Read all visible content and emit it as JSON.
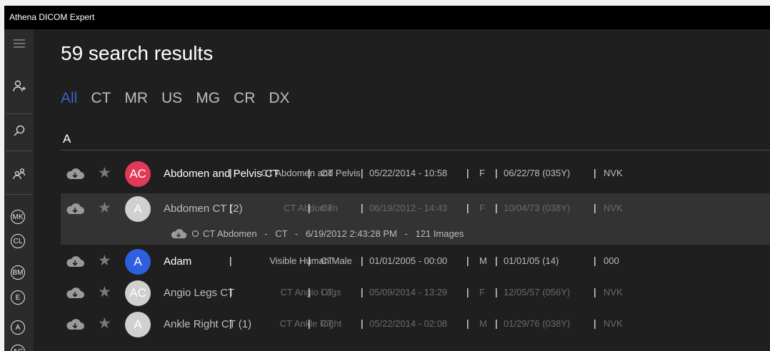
{
  "app": {
    "title": "Athena DICOM Expert"
  },
  "sidebar": {
    "recent_patients": [
      "MK",
      "CL",
      "BM",
      "E",
      "A",
      "AC"
    ]
  },
  "results": {
    "heading": "59 search results",
    "tabs": [
      "All",
      "CT",
      "MR",
      "US",
      "MG",
      "CR",
      "DX"
    ],
    "active_tab": "All",
    "group_letter": "A"
  },
  "patients": [
    {
      "initials": "AC",
      "avatar_color": "#e03a57",
      "name": "Abdomen and Pelvis CT",
      "study": "CT Abdomen and Pelvis",
      "modality": "CT",
      "date": "05/22/2014 - 10:58",
      "sex": "F",
      "dob": "06/22/78 (035Y)",
      "extra": "NVK",
      "dim": false
    },
    {
      "initials": "A",
      "avatar_color": "#d0d0d0",
      "name": "Abdomen CT (2)",
      "study": "CT Abdomen",
      "modality": "CT",
      "date": "06/19/2012 - 14:43",
      "sex": "F",
      "dob": "10/04/73 (038Y)",
      "extra": "NVK",
      "dim": true
    },
    {
      "initials": "A",
      "avatar_color": "#2f5fe0",
      "name": "Adam",
      "study": "Visible Human Male",
      "modality": "CT",
      "date": "01/01/2005 - 00:00",
      "sex": "M",
      "dob": "01/01/05 (14)",
      "extra": "000",
      "dim": false
    },
    {
      "initials": "AC",
      "avatar_color": "#d0d0d0",
      "name": "Angio Legs CT",
      "study": "CT Angio Legs",
      "modality": "CT",
      "date": "05/09/2014 - 13:29",
      "sex": "F",
      "dob": "12/05/57 (056Y)",
      "extra": "NVK",
      "dim": true
    },
    {
      "initials": "A",
      "avatar_color": "#d0d0d0",
      "name": "Ankle Right CT (1)",
      "study": "CT Ankle Right",
      "modality": "CT",
      "date": "05/22/2014 - 02:08",
      "sex": "M",
      "dob": "01/29/76 (038Y)",
      "extra": "NVK",
      "dim": true
    }
  ],
  "series": {
    "description": "CT Abdomen",
    "modality": "CT",
    "datetime": "6/19/2012 2:43:28 PM",
    "images": "121 Images",
    "sep": "-"
  },
  "colors": {
    "accent": "#3a64c8",
    "background": "#1f1f1f",
    "sidebar": "#2b2b2b"
  },
  "pipe": "|"
}
